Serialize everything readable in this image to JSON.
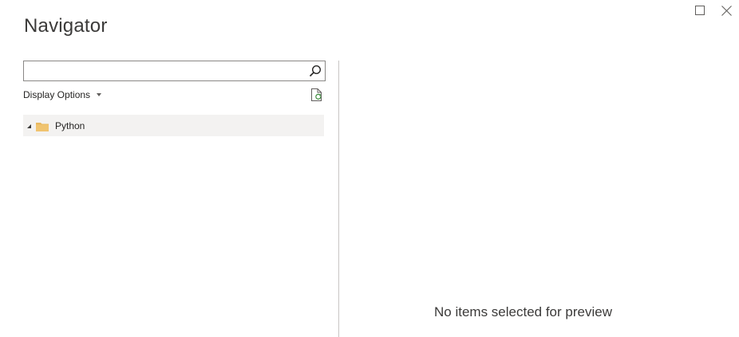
{
  "window": {
    "title": "Navigator",
    "maximize_icon": "maximize-icon",
    "close_icon": "close-icon"
  },
  "navigator": {
    "search": {
      "value": "",
      "placeholder": "",
      "icon": "search-icon"
    },
    "display_options_label": "Display Options",
    "refresh_icon": "refresh-icon",
    "tree": [
      {
        "label": "Python",
        "icon": "folder-icon",
        "expanded": true
      }
    ]
  },
  "preview": {
    "empty_message": "No items selected for preview"
  },
  "colors": {
    "folder": "#e8b960",
    "selected_row": "#f3f2f1",
    "divider": "#c8c6c4"
  }
}
